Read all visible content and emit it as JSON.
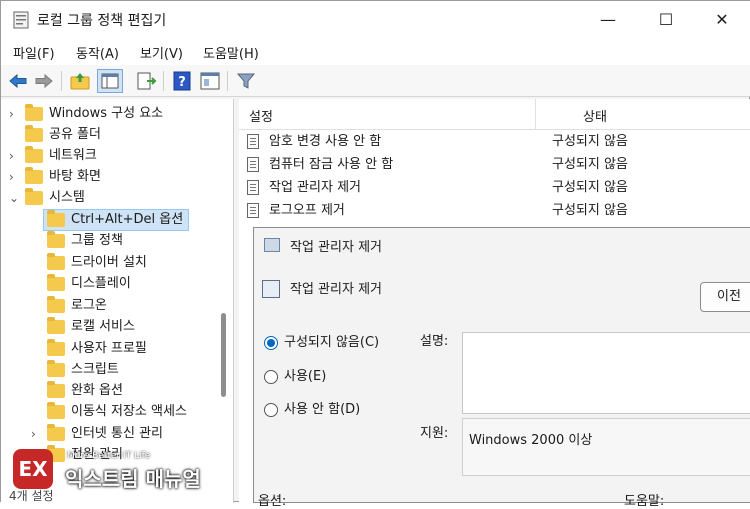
{
  "window": {
    "title": "로컬 그룹 정책 편집기",
    "controls": {
      "minimize": "—",
      "maximize": "☐",
      "close": "✕"
    }
  },
  "menu": {
    "items": [
      "파일(F)",
      "동작(A)",
      "보기(V)",
      "도움말(H)"
    ]
  },
  "toolbar": {
    "icons": [
      "back-arrow-icon",
      "forward-arrow-icon",
      "up-folder-icon",
      "show-hide-tree-icon",
      "export-list-icon",
      "help-icon",
      "properties-icon",
      "filter-icon"
    ]
  },
  "tree": {
    "items": [
      {
        "label": "Windows 구성 요소",
        "expander": "›"
      },
      {
        "label": "공유 폴더",
        "expander": ""
      },
      {
        "label": "네트워크",
        "expander": "›"
      },
      {
        "label": "바탕 화면",
        "expander": "›"
      },
      {
        "label": "시스템",
        "expander": "⌄"
      },
      {
        "label": "Ctrl+Alt+Del 옵션",
        "expander": ""
      },
      {
        "label": "그룹 정책",
        "expander": ""
      },
      {
        "label": "드라이버 설치",
        "expander": ""
      },
      {
        "label": "디스플레이",
        "expander": ""
      },
      {
        "label": "로그온",
        "expander": ""
      },
      {
        "label": "로캘 서비스",
        "expander": ""
      },
      {
        "label": "사용자 프로필",
        "expander": ""
      },
      {
        "label": "스크립트",
        "expander": ""
      },
      {
        "label": "완화 옵션",
        "expander": ""
      },
      {
        "label": "이동식 저장소 액세스",
        "expander": ""
      },
      {
        "label": "인터넷 통신 관리",
        "expander": "›"
      },
      {
        "label": "전원 관리",
        "expander": ""
      }
    ],
    "selected": "Ctrl+Alt+Del 옵션"
  },
  "list": {
    "columns": {
      "setting": "설정",
      "state": "상태"
    },
    "rows": [
      {
        "name": "암호 변경 사용 안 함",
        "state": "구성되지 않음"
      },
      {
        "name": "컴퓨터 잠금 사용 안 함",
        "state": "구성되지 않음"
      },
      {
        "name": "작업 관리자 제거",
        "state": "구성되지 않음"
      },
      {
        "name": "로그오프 제거",
        "state": "구성되지 않음"
      }
    ]
  },
  "dialog": {
    "title": "작업 관리자 제거",
    "policy_name": "작업 관리자 제거",
    "prev_button": "이전",
    "options": [
      {
        "label": "구성되지 않음(C)",
        "checked": true
      },
      {
        "label": "사용(E)",
        "checked": false
      },
      {
        "label": "사용 안 함(D)",
        "checked": false
      }
    ],
    "comment_label": "설명:",
    "supported_label": "지원:",
    "supported_value": "Windows 2000 이상",
    "options_label": "옵션:",
    "help_label": "도움말:"
  },
  "status": {
    "tail_text": "4개 설정"
  },
  "watermark": {
    "tagline": "More Better IT Life",
    "name": "익스트림 매뉴얼",
    "logo": "EX"
  }
}
